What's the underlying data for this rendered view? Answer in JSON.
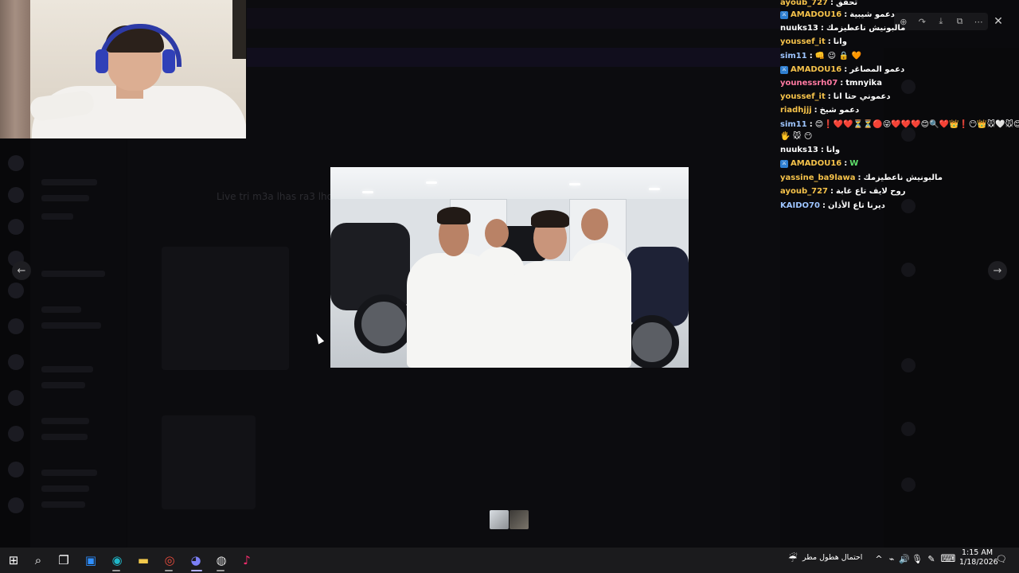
{
  "window_controls": {
    "minimize": "—",
    "maximize": "▢",
    "close": "✕"
  },
  "viewer": {
    "toolbar": [
      {
        "name": "zoom-icon",
        "glyph": "⊕"
      },
      {
        "name": "forward-icon",
        "glyph": "↷"
      },
      {
        "name": "download-icon",
        "glyph": "⤓"
      },
      {
        "name": "open-external-icon",
        "glyph": "⧉"
      },
      {
        "name": "more-icon",
        "glyph": "⋯"
      }
    ],
    "close_glyph": "✕",
    "prev_glyph": "←",
    "next_glyph": "→"
  },
  "background": {
    "ghost_text": "Live tri m3a lhas ra3 lho"
  },
  "chat": {
    "colors": {
      "mod_badge": "#2f7fd1",
      "white": "#ffffff"
    },
    "lines": [
      {
        "user": "ayoub_727",
        "color": "#f5c24a",
        "badge": false,
        "sep": ":",
        "msg": "تحقق"
      },
      {
        "user": "AMADOU16",
        "color": "#f5c24a",
        "badge": true,
        "sep": ":",
        "msg": "دعمو شيبية"
      },
      {
        "user": "nuuks13",
        "color": "#ffffff",
        "badge": false,
        "sep": ":",
        "msg": "مالبونيش ناعطيزمك"
      },
      {
        "user": "youssef_it",
        "color": "#f5c24a",
        "badge": false,
        "sep": ":",
        "msg": "وانا"
      },
      {
        "user": "sim11",
        "color": "#9ec5ff",
        "badge": false,
        "sep": ":",
        "msg": "👊 😉 🔒 🧡"
      },
      {
        "user": "AMADOU16",
        "color": "#f5c24a",
        "badge": true,
        "sep": ":",
        "msg": "دعمو المصاغر"
      },
      {
        "user": "younessrh07",
        "color": "#ff7aa2",
        "badge": false,
        "sep": ":",
        "msg": "tmnyika"
      },
      {
        "user": "youssef_it",
        "color": "#f5c24a",
        "badge": false,
        "sep": ":",
        "msg": "دعموني حتا انا"
      },
      {
        "user": "riadhjjj",
        "color": "#f5c24a",
        "badge": false,
        "sep": ":",
        "msg": "دعمو شيخ"
      },
      {
        "user": "sim11",
        "color": "#9ec5ff",
        "badge": false,
        "sep": ":",
        "msg": "😊❗❤️❤️⏳⏳🔴😜❤️❤️❤️😊🔍❤️👑❗😶👑🐭🤍🐭😊❤️"
      },
      {
        "user": "",
        "color": "#ffffff",
        "badge": false,
        "sep": "",
        "msg": "🖐 🐭 😶"
      },
      {
        "user": "nuuks13",
        "color": "#ffffff",
        "badge": false,
        "sep": ":",
        "msg": "وانا"
      },
      {
        "user": "AMADOU16",
        "color": "#f5c24a",
        "badge": true,
        "sep": ":",
        "msg": "W"
      },
      {
        "user": "yassine_ba9lawa",
        "color": "#f5c24a",
        "badge": false,
        "sep": ":",
        "msg": "مالبونيش ناعطيزمك"
      },
      {
        "user": "ayoub_727",
        "color": "#f5c24a",
        "badge": false,
        "sep": ":",
        "msg": "روح لايف تاع غابة"
      },
      {
        "user": "KAIDO70",
        "color": "#9ec5ff",
        "badge": false,
        "sep": ":",
        "msg": "ديرنا تاع الأذان"
      }
    ]
  },
  "taskbar": {
    "icons": [
      {
        "name": "windows-start-icon",
        "glyph": "⊞",
        "color": "#ffffff"
      },
      {
        "name": "search-icon",
        "glyph": "⌕",
        "color": "#ffffff"
      },
      {
        "name": "task-view-icon",
        "glyph": "❐",
        "color": "#ffffff"
      },
      {
        "name": "store-icon",
        "glyph": "▣",
        "color": "#2f8fff"
      },
      {
        "name": "edge-icon",
        "glyph": "◉",
        "color": "#1fb7c9"
      },
      {
        "name": "file-explorer-icon",
        "glyph": "▬",
        "color": "#f2c94c"
      },
      {
        "name": "chrome-icon",
        "glyph": "◎",
        "color": "#e84c3d"
      },
      {
        "name": "discord-icon",
        "glyph": "◕",
        "color": "#7b7ff5"
      },
      {
        "name": "obs-icon",
        "glyph": "◍",
        "color": "#dddddd"
      },
      {
        "name": "tiktok-icon",
        "glyph": "♪",
        "color": "#ff2d6f"
      }
    ],
    "weather_text": "احتمال هطول مطر",
    "weather_icon": "☔",
    "tray": {
      "chevron": "^",
      "network": "⌁",
      "volume": "🔊",
      "mic": "🎙",
      "pen": "✎",
      "keyboard": "⌨",
      "notification": "🗨"
    },
    "time": "1:15 AM",
    "date": "1/18/2026"
  }
}
